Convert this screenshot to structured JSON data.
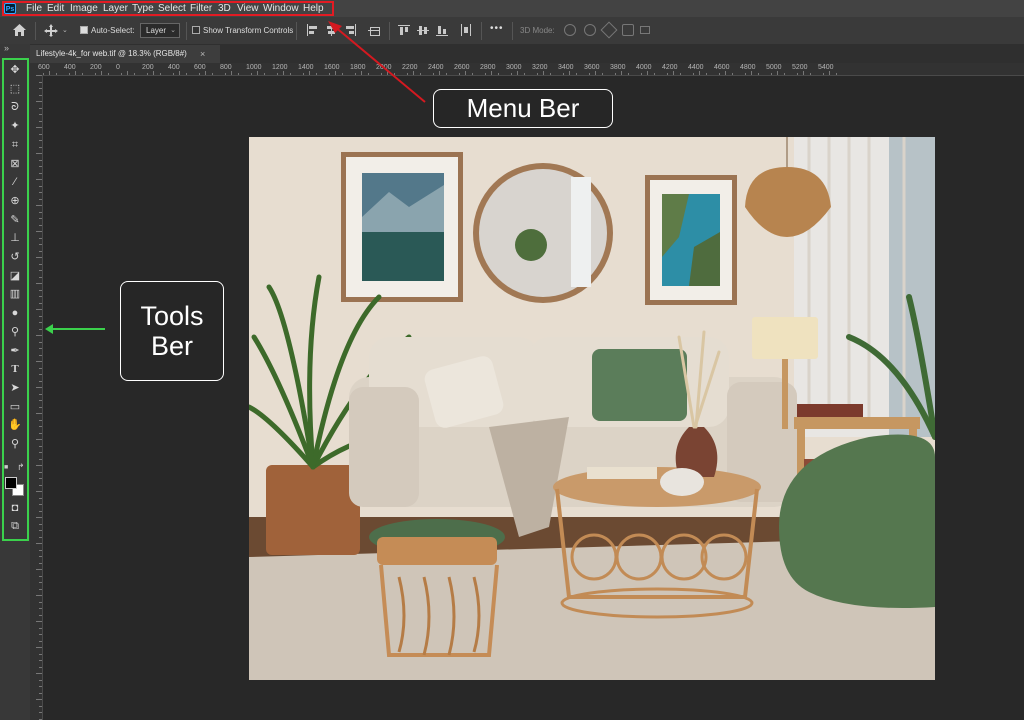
{
  "app": {
    "logo_text": "Ps"
  },
  "menu": {
    "items": [
      "File",
      "Edit",
      "Image",
      "Layer",
      "Type",
      "Select",
      "Filter",
      "3D",
      "View",
      "Window",
      "Help"
    ]
  },
  "options": {
    "auto_select_label": "Auto-Select:",
    "layer_value": "Layer",
    "show_transform_label": "Show Transform Controls",
    "more_label": "•••",
    "mode_3d_label": "3D Mode:"
  },
  "document": {
    "tab_title": "Lifestyle-4k_for web.tif @ 18.3% (RGB/8#)",
    "close_glyph": "×"
  },
  "ruler": {
    "labels": [
      "600",
      "400",
      "200",
      "0",
      "200",
      "400",
      "600",
      "800",
      "1000",
      "1200",
      "1400",
      "1600",
      "1800",
      "2000",
      "2200",
      "2400",
      "2600",
      "2800",
      "3000",
      "3200",
      "3400",
      "3600",
      "3800",
      "4000",
      "4200",
      "4400",
      "4600",
      "4800",
      "5000",
      "5200",
      "5400"
    ]
  },
  "toolbar": {
    "expand_glyph": "»",
    "tools": [
      {
        "name": "move-tool-icon",
        "glyph": "✥"
      },
      {
        "name": "marquee-tool-icon",
        "glyph": "⬚"
      },
      {
        "name": "lasso-tool-icon",
        "glyph": "ᘐ"
      },
      {
        "name": "magic-wand-tool-icon",
        "glyph": "✦"
      },
      {
        "name": "crop-tool-icon",
        "glyph": "⌗"
      },
      {
        "name": "frame-tool-icon",
        "glyph": "⊠"
      },
      {
        "name": "eyedropper-tool-icon",
        "glyph": "⁄"
      },
      {
        "name": "healing-brush-tool-icon",
        "glyph": "⊕"
      },
      {
        "name": "brush-tool-icon",
        "glyph": "✎"
      },
      {
        "name": "clone-stamp-tool-icon",
        "glyph": "⊥"
      },
      {
        "name": "history-brush-tool-icon",
        "glyph": "↺"
      },
      {
        "name": "eraser-tool-icon",
        "glyph": "◪"
      },
      {
        "name": "gradient-tool-icon",
        "glyph": "▥"
      },
      {
        "name": "blur-tool-icon",
        "glyph": "●"
      },
      {
        "name": "dodge-tool-icon",
        "glyph": "⚲"
      },
      {
        "name": "pen-tool-icon",
        "glyph": "✒"
      },
      {
        "name": "type-tool-icon",
        "glyph": "T"
      },
      {
        "name": "path-selection-tool-icon",
        "glyph": "➤"
      },
      {
        "name": "rectangle-tool-icon",
        "glyph": "▭"
      },
      {
        "name": "hand-tool-icon",
        "glyph": "✋"
      },
      {
        "name": "zoom-tool-icon",
        "glyph": "⚲"
      }
    ],
    "extra": [
      {
        "name": "quick-mask-icon",
        "glyph": "◘"
      },
      {
        "name": "screen-mode-icon",
        "glyph": "⧉"
      }
    ]
  },
  "annotations": {
    "menu_bar_label": "Menu Ber",
    "tools_bar_label_line1": "Tools",
    "tools_bar_label_line2": "Ber"
  },
  "colors": {
    "menu_highlight": "#e31b23",
    "tools_highlight": "#3bd14c",
    "foreground_swatch": "#000000",
    "background_swatch": "#ffffff"
  }
}
